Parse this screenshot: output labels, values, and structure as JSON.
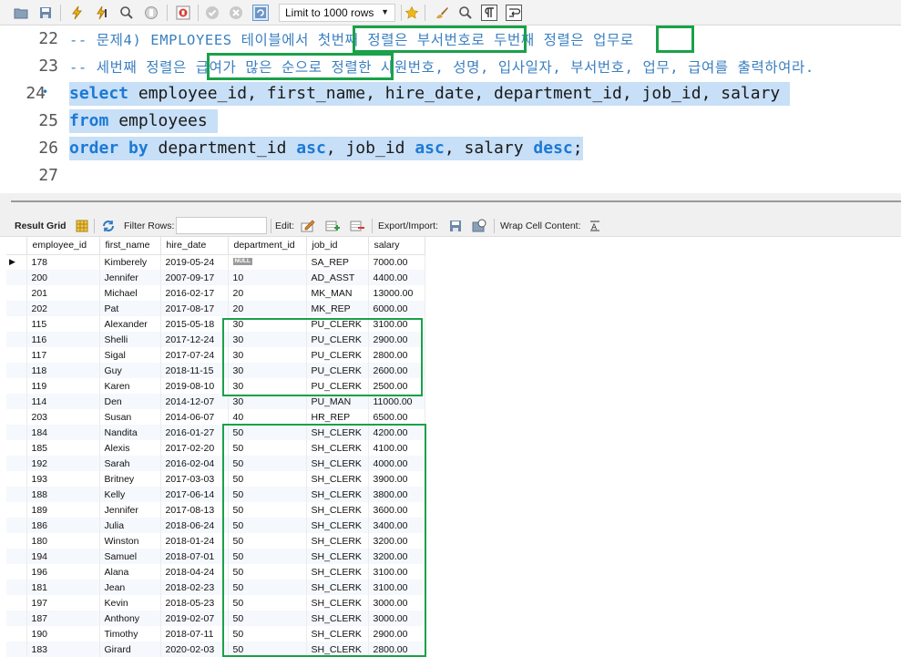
{
  "toolbar": {
    "limit_label": "Limit to 1000 rows",
    "icons": [
      "folder-icon",
      "save-icon",
      "lightning-icon",
      "lightning-cursor-icon",
      "magnifier-icon",
      "stop-icon",
      "stop-error-icon",
      "commit-icon",
      "rollback-icon",
      "autocommit-icon",
      "star-icon",
      "brush-icon",
      "search-icon",
      "paragraph-icon",
      "wrap-icon"
    ]
  },
  "editor": {
    "lines": [
      {
        "num": "22",
        "type": "comment",
        "text": "-- 문제4) EMPLOYEES 테이블에서 첫번째 정렬은 부서번호로 두번째 정렬은 업무로"
      },
      {
        "num": "23",
        "type": "comment",
        "text": "-- 세번째 정렬은 급여가 많은 순으로 정렬한 사원번호, 성명, 입사일자, 부서번호, 업무, 급여를 출력하여라."
      },
      {
        "num": "24",
        "type": "code",
        "marker": "•",
        "kw1": "select",
        "rest": " employee_id, first_name, hire_date, department_id, job_id, salary"
      },
      {
        "num": "25",
        "type": "code",
        "kw1": "from",
        "rest": " employees"
      },
      {
        "num": "26",
        "type": "order",
        "kw1": "order by",
        "p1": " department_id ",
        "kw2": "asc",
        "p2": ", job_id ",
        "kw3": "asc",
        "p3": ", salary ",
        "kw4": "desc",
        "p4": ";"
      },
      {
        "num": "27",
        "type": "empty",
        "text": ""
      }
    ]
  },
  "result_toolbar": {
    "result_grid": "Result Grid",
    "filter_rows": "Filter Rows:",
    "edit": "Edit:",
    "export_import": "Export/Import:",
    "wrap_cell": "Wrap Cell Content:"
  },
  "grid": {
    "columns": [
      "employee_id",
      "first_name",
      "hire_date",
      "department_id",
      "job_id",
      "salary"
    ],
    "null_label": "NULL",
    "rows": [
      [
        "178",
        "Kimberely",
        "2019-05-24",
        "NULL",
        "SA_REP",
        "7000.00"
      ],
      [
        "200",
        "Jennifer",
        "2007-09-17",
        "10",
        "AD_ASST",
        "4400.00"
      ],
      [
        "201",
        "Michael",
        "2016-02-17",
        "20",
        "MK_MAN",
        "13000.00"
      ],
      [
        "202",
        "Pat",
        "2017-08-17",
        "20",
        "MK_REP",
        "6000.00"
      ],
      [
        "115",
        "Alexander",
        "2015-05-18",
        "30",
        "PU_CLERK",
        "3100.00"
      ],
      [
        "116",
        "Shelli",
        "2017-12-24",
        "30",
        "PU_CLERK",
        "2900.00"
      ],
      [
        "117",
        "Sigal",
        "2017-07-24",
        "30",
        "PU_CLERK",
        "2800.00"
      ],
      [
        "118",
        "Guy",
        "2018-11-15",
        "30",
        "PU_CLERK",
        "2600.00"
      ],
      [
        "119",
        "Karen",
        "2019-08-10",
        "30",
        "PU_CLERK",
        "2500.00"
      ],
      [
        "114",
        "Den",
        "2014-12-07",
        "30",
        "PU_MAN",
        "11000.00"
      ],
      [
        "203",
        "Susan",
        "2014-06-07",
        "40",
        "HR_REP",
        "6500.00"
      ],
      [
        "184",
        "Nandita",
        "2016-01-27",
        "50",
        "SH_CLERK",
        "4200.00"
      ],
      [
        "185",
        "Alexis",
        "2017-02-20",
        "50",
        "SH_CLERK",
        "4100.00"
      ],
      [
        "192",
        "Sarah",
        "2016-02-04",
        "50",
        "SH_CLERK",
        "4000.00"
      ],
      [
        "193",
        "Britney",
        "2017-03-03",
        "50",
        "SH_CLERK",
        "3900.00"
      ],
      [
        "188",
        "Kelly",
        "2017-06-14",
        "50",
        "SH_CLERK",
        "3800.00"
      ],
      [
        "189",
        "Jennifer",
        "2017-08-13",
        "50",
        "SH_CLERK",
        "3600.00"
      ],
      [
        "186",
        "Julia",
        "2018-06-24",
        "50",
        "SH_CLERK",
        "3400.00"
      ],
      [
        "180",
        "Winston",
        "2018-01-24",
        "50",
        "SH_CLERK",
        "3200.00"
      ],
      [
        "194",
        "Samuel",
        "2018-07-01",
        "50",
        "SH_CLERK",
        "3200.00"
      ],
      [
        "196",
        "Alana",
        "2018-04-24",
        "50",
        "SH_CLERK",
        "3100.00"
      ],
      [
        "181",
        "Jean",
        "2018-02-23",
        "50",
        "SH_CLERK",
        "3100.00"
      ],
      [
        "197",
        "Kevin",
        "2018-05-23",
        "50",
        "SH_CLERK",
        "3000.00"
      ],
      [
        "187",
        "Anthony",
        "2019-02-07",
        "50",
        "SH_CLERK",
        "3000.00"
      ],
      [
        "190",
        "Timothy",
        "2018-07-11",
        "50",
        "SH_CLERK",
        "2900.00"
      ],
      [
        "183",
        "Girard",
        "2020-02-03",
        "50",
        "SH_CLERK",
        "2800.00"
      ]
    ]
  },
  "colors": {
    "highlight_box": "#1aa14a",
    "keyword": "#1c79d4",
    "selection": "#c7dff7",
    "comment": "#3a7fc0"
  }
}
